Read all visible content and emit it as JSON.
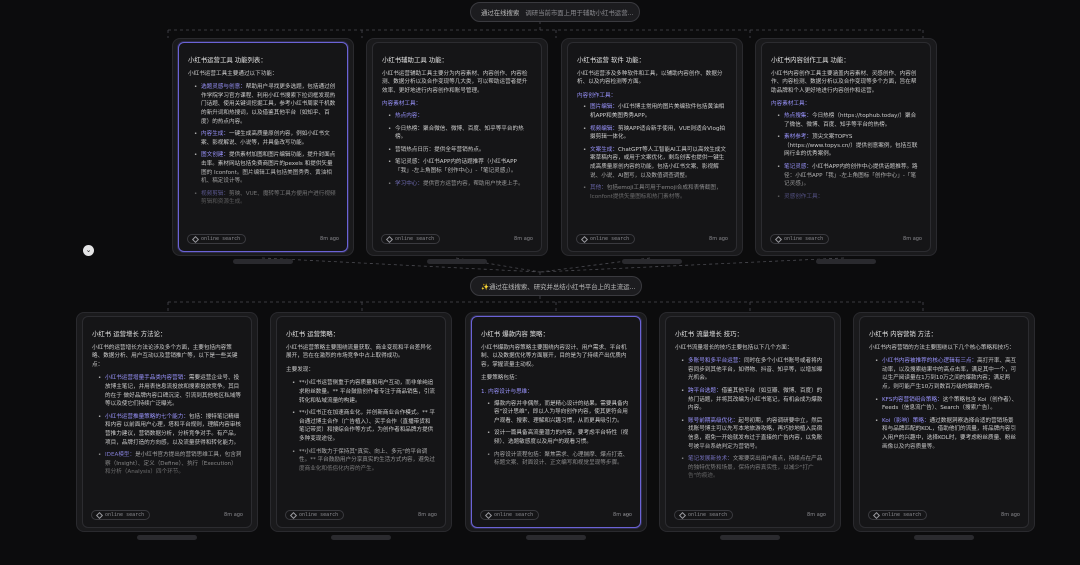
{
  "top_pill": {
    "label": "通过在线搜索",
    "text": "调研当前市面上用于辅助小红书运营..."
  },
  "mid_pill": {
    "label": "✨通过在线搜索、研究并总结小红书平台上的主流运...",
    "text": ""
  },
  "row1": [
    {
      "title": "小红书运营工具 功能列表：",
      "intro": "小红书运营工具主要通过以下功能：",
      "items": [
        {
          "h": "选题灵感与创意：",
          "t": "帮助用户寻找更多选题，包括通过创作学院学习官方课程、利用小红书搜索下拉词框发现热门话题、使用关键词挖掘工具，参考小红书周家千机数的新升词和热搜词，以及借鉴其他平台（如知乎、百度）的热点内容。"
        },
        {
          "h": "内容生成：",
          "t": "一键生成高质量原创内容，例如小红书文案、影视解说、小说等，并具备改写功能。"
        },
        {
          "h": "图文创建：",
          "t": "提供素材加图和图片编辑功能，提升封面点击率。素材网站包括免费商图片的pexels 和提供矢量图的 Iconfont。图片编辑工具包括美图秀秀、黄油相机、稿定设计等。"
        },
        {
          "h": "视频剪辑：",
          "t": "剪映、VUE、魔转等工具方便用户进行视频剪辑和资源生成。"
        }
      ],
      "foot_tag": "online search",
      "foot_time": "8m ago"
    },
    {
      "title": "小红书辅助工具 功能：",
      "intro": "小红书运营辅助工具主要分为内容素材、内容创作、内容检测、数据分析以及合作变现等几大类，可以帮助运营者提升效率、更好地进行内容创作和账号管理。",
      "sec": "内容素材工具：",
      "items": [
        {
          "h": "热点内容：",
          "t": ""
        },
        {
          "h": "",
          "t": "今日热榜：聚合微信、微博、百度、知乎等平台的热榜。"
        },
        {
          "h": "",
          "t": "营销热点日历：提供全年营销热点。"
        },
        {
          "h": "",
          "t": "笔记灵感：小红书APP内的话题推荐（小红书APP「我」-左上角图标「创作中心」-「笔记灵感」）。"
        },
        {
          "h": "学习中心：",
          "t": "提供官方运营内容，帮助用户快速上手。"
        }
      ],
      "foot_tag": "online search",
      "foot_time": "8m ago"
    },
    {
      "title": "小红书运营 软件 功能：",
      "intro": "小红书运营涉及多种软件和工具，以辅助内容创作、数据分析、以及内容检测等方面。",
      "sec": "内容创作工具：",
      "items": [
        {
          "h": "图片编辑：",
          "t": "小红书博主常用的图片美编软件包括黄油相机APP和美图秀秀APP。"
        },
        {
          "h": "视频编辑：",
          "t": "剪映APP适合新手使用，VUE则适合Vlog拍摄剪辑一体化。"
        },
        {
          "h": "文案生成：",
          "t": "ChatGPT等人工智能AI工具可以高效生成文案草稿内容，或用于文案优化，剩鸟创客也提供一键生成高质量原创内容的功能，包括小红书文案、影视解说、小说、AI图写，以及数值调查调整。"
        },
        {
          "h": "其他：",
          "t": "包括emoji工具可用于emoji合成和表情截图，Iconfont提供矢量图标和热门素材等。"
        }
      ],
      "foot_tag": "online search",
      "foot_time": "8m ago"
    },
    {
      "title": "小红书内容创作工具 功能：",
      "intro": "小红书内容创作工具主要涵盖内容素材、灵感创作、内容创作、内容检测、数据分析以及合作变现等多个方面，旨在帮助品牌和个人更好地进行内容创作和运营。",
      "sec": "内容素材工具：",
      "items": [
        {
          "h": "热点搜集：",
          "t": "今日热榜（https://tophub.today/）聚合了微信、微博、百度、知乎等平台的热榜。"
        },
        {
          "h": "素材参考：",
          "t": "顶尖文案TOPYS（https://www.topys.cn/）提供创意案例，包括互联网行业的优秀案例。"
        },
        {
          "h": "笔记灵感：",
          "t": "小红书APP内的创作中心提供话题推荐。路径：小红书APP「我」-左上角图标「创作中心」-「笔记灵感」。"
        },
        {
          "h": "灵感创作工具：",
          "t": ""
        }
      ],
      "foot_tag": "online search",
      "foot_time": "8m ago"
    }
  ],
  "row2": [
    {
      "title": "小红书 运营增长 方法论：",
      "intro": "小红书的运营增长方法论涉及多个方面，主要包括内容策略、数据分析、用户互动以及营销推广等，以下是一些关键点：",
      "items": [
        {
          "h": "小红书运营增量手品类内容营销：",
          "t": "需要运营企业号、投放博主笔记，并用表信息流投放和搜索投放竞争。其目的在于 做好品牌内容口碑沉淀、引流到其他地区私域等等以及使它们持续广泛曝光。"
        },
        {
          "h": "小红书运营推量策略的七个能力：",
          "t": "包括：搜特笔记精细和内容 以前面用户心理，塔和平台规则，理解内容审核营推力建议，营销数据分析，分析竞争对手。有产品，项目，品牌打造的方向感，以及流量获得和转化能力。"
        },
        {
          "h": "IDEA模型：",
          "t": "是小红书官方提出的营销思维工具，包含洞察（Insight）、定义（Define）、执行（Execution）和分析（Analysis）四个环节。"
        }
      ],
      "foot_tag": "online search",
      "foot_time": "8m ago"
    },
    {
      "title": "小红书 运营策略：",
      "intro": "小红书运营策略主要围绕流量获取、商业变现和平台差异化展开，旨在在激烈的市场竞争中占上取得成功。",
      "sec_plain": "主要发现：",
      "items": [
        {
          "h": "",
          "t": "**小红书运营侧重于内容质量和用户互动，而非单纯追求粉丝数量。** 平台鼓励创作者专注于商品销售，引流转化和私域流量的构建。"
        },
        {
          "h": "",
          "t": "**小红书正在加速商业化，并创新商业合作模式。** 平台通过博主合作（广告植入）、买手合作（直播带货和笔记带货）和搜综合作等方式，为创作者和品牌方提供多种变现途径。"
        },
        {
          "h": "",
          "t": "**小红书致力于保持其\"真实、向上、多元\"的平台调性。** 平台鼓励用户分享真实的生活方式内容，避免过度商业化和低俗化内容的产生。"
        }
      ],
      "foot_tag": "online search",
      "foot_time": "8m ago"
    },
    {
      "title": "小红书 爆款内容 策略：",
      "intro": "小红书爆款内容策略主要围绕内容设计、用户需求、平台机制、以及数据优化等方面展开，目的是为了持续产出优质内容，掌握流量主动权。",
      "sec_plain": "主要策略包括：",
      "ol_title": "1. 内容设计与思维：",
      "items": [
        {
          "h": "",
          "t": "爆款内容并非偶然，而是精心设计的结果。需要具备内容\"设计思维\"，即以人为导向创作内容，使其更符合用户观看、搜索、理解和兴趣习惯，从而更具吸引力。"
        },
        {
          "h": "",
          "t": "设计一篇具备高流量潜力的内容，要考虑平台特性（视频）、选题敏感度以及用户的观看习惯。"
        },
        {
          "h": "",
          "t": "内容设计流程包括：聚焦需求、心理揣摩、爆点打造、标题文案、封面设计、正文编写和视觉呈现等步骤。"
        }
      ],
      "foot_tag": "online search",
      "foot_time": "8m ago"
    },
    {
      "title": "小红书 流量增长 技巧：",
      "intro": "小红书流量增长的技巧主要包括以下几个方面：",
      "items": [
        {
          "h": "多账号和多平台运营：",
          "t": "同时在多个小红书账号或者将内容同步到其他平台，如得物、抖音、知乎等，以增加曝光机会。"
        },
        {
          "h": "跨平台选题：",
          "t": "借鉴其他平台（如豆瓣、微博、百度）的热门话题，并将其改编为小红书笔记，有机会成为爆款内容。"
        },
        {
          "h": "账号前期高级优化：",
          "t": "起号初期，内容调研要中立，然后找账号博主可以先写本地旅游攻略，再巧妙地植入民宿信息，避免一开始就发布过于直接的广告内容，以免账号被平台系统判定为营销号。"
        },
        {
          "h": "笔记发展新技术：",
          "t": "文案要突出用户痛点，持续点在产品的独特优势和场景，保持内容真实性，以减少\"打广告\"的痕迹。"
        }
      ],
      "foot_tag": "online search",
      "foot_time": "8m ago"
    },
    {
      "title": "小红书 内容营销 方法：",
      "intro": "小红书内容营销的方法主要围绕以下几个核心策略和技巧：",
      "items": [
        {
          "h": "小红书内容被推荐的核心逻辑有三点：",
          "t": "高打开率、高互动率，以及搜索结果中的高点击率，满足其中一个，可以生产阅读量在1万到10万之间的爆款内容；满足两点，则可能产生10万到数百万级的爆款内容。"
        },
        {
          "h": "KFS内容营销组合策略：",
          "t": "这个策略包含 Koi（创作者）、Feeds（信息流广告）、Search（搜索广告）。"
        },
        {
          "h": "Koi（影响）策略：",
          "t": "通过数据洞察选择合适的营销场景和与品牌匹配的KOL，借助他们的流量，将品牌内容引入用户的兴趣中，选择KOL时，要考虑粉丝质量、粉丝画像以及内容质量等。"
        }
      ],
      "foot_tag": "online search",
      "foot_time": "8m ago"
    }
  ]
}
